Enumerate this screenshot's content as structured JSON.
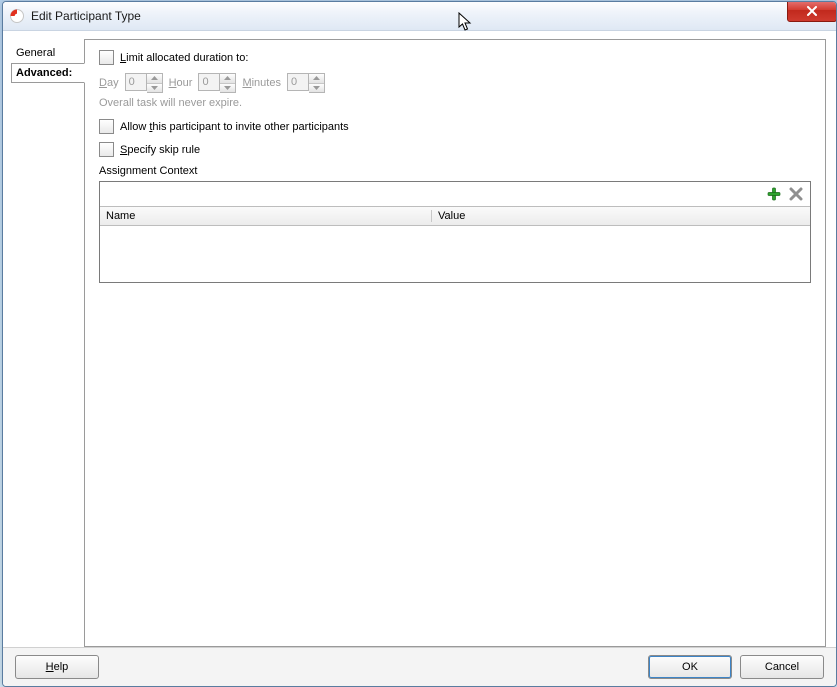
{
  "window": {
    "title": "Edit Participant Type"
  },
  "tabs": {
    "general": "General",
    "advanced": "Advanced:"
  },
  "options": {
    "limit_duration_prefix": "L",
    "limit_duration_rest": "imit allocated duration to:",
    "day_prefix": "D",
    "day_rest": "ay",
    "day_val": "0",
    "hour_prefix": "H",
    "hour_rest": "our",
    "hour_val": "0",
    "minutes_prefix": "M",
    "minutes_rest": "inutes",
    "minutes_val": "0",
    "expire_hint": "Overall task will never expire.",
    "allow_invite_pre": "Allow ",
    "allow_invite_u": "t",
    "allow_invite_post": "his participant to invite other participants",
    "skip_pre": "",
    "skip_u": "S",
    "skip_post": "pecify skip rule",
    "assignment_context": "Assignment Context",
    "col_name": "Name",
    "col_value": "Value"
  },
  "buttons": {
    "help_u": "H",
    "help_rest": "elp",
    "ok": "OK",
    "cancel": "Cancel"
  }
}
